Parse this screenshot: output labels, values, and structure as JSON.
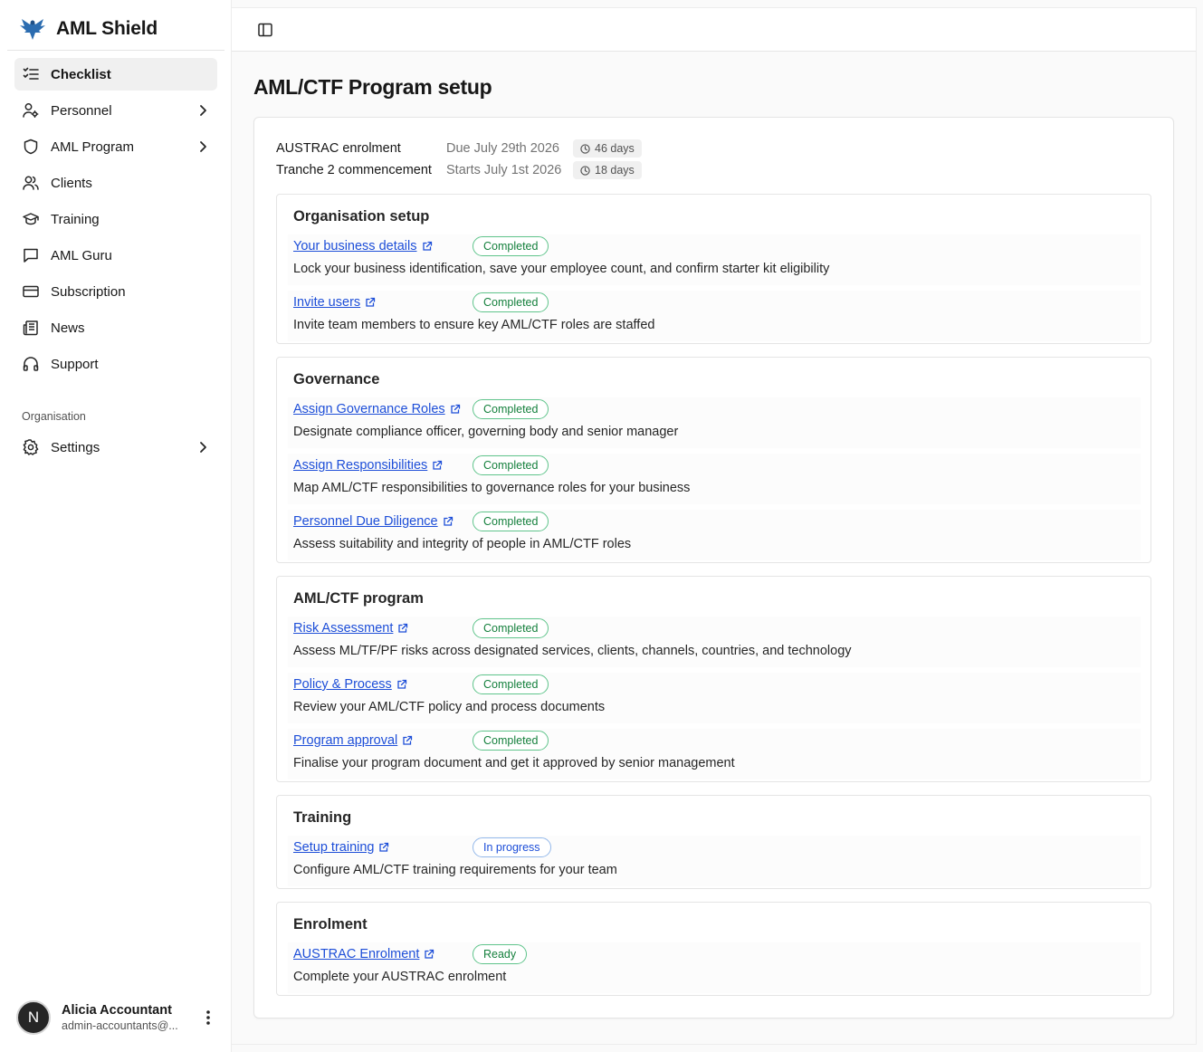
{
  "brand": {
    "name": "AML Shield",
    "logo_icon": "eagle-logo-icon",
    "accent": "#2b6cb0"
  },
  "sidebar": {
    "items": [
      {
        "label": "Checklist",
        "icon": "checklist-icon",
        "active": true,
        "has_chevron": false
      },
      {
        "label": "Personnel",
        "icon": "user-cog-icon",
        "active": false,
        "has_chevron": true
      },
      {
        "label": "AML Program",
        "icon": "shield-icon",
        "active": false,
        "has_chevron": true
      },
      {
        "label": "Clients",
        "icon": "users-icon",
        "active": false,
        "has_chevron": false
      },
      {
        "label": "Training",
        "icon": "graduation-cap-icon",
        "active": false,
        "has_chevron": false
      },
      {
        "label": "AML Guru",
        "icon": "message-square-icon",
        "active": false,
        "has_chevron": false
      },
      {
        "label": "Subscription",
        "icon": "credit-card-icon",
        "active": false,
        "has_chevron": false
      },
      {
        "label": "News",
        "icon": "newspaper-icon",
        "active": false,
        "has_chevron": false
      },
      {
        "label": "Support",
        "icon": "headphones-icon",
        "active": false,
        "has_chevron": false
      }
    ],
    "section_label": "Organisation",
    "settings": {
      "label": "Settings",
      "icon": "gear-icon"
    }
  },
  "user": {
    "initial": "N",
    "name": "Alicia Accountant",
    "email": "admin-accountants@..."
  },
  "page": {
    "title": "AML/CTF Program setup"
  },
  "deadlines": [
    {
      "label": "AUSTRAC enrolment",
      "date": "Due July 29th 2026",
      "badge": "46 days"
    },
    {
      "label": "Tranche 2 commencement",
      "date": "Starts July 1st 2026",
      "badge": "18 days"
    }
  ],
  "sections": [
    {
      "title": "Organisation setup",
      "tasks": [
        {
          "link": "Your business details",
          "status": "Completed",
          "desc": "Lock your business identification, save your employee count, and confirm starter kit eligibility"
        },
        {
          "link": "Invite users",
          "status": "Completed",
          "desc": "Invite team members to ensure key AML/CTF roles are staffed"
        }
      ]
    },
    {
      "title": "Governance",
      "tasks": [
        {
          "link": "Assign Governance Roles",
          "status": "Completed",
          "desc": "Designate compliance officer, governing body and senior manager"
        },
        {
          "link": "Assign Responsibilities",
          "status": "Completed",
          "desc": "Map AML/CTF responsibilities to governance roles for your business"
        },
        {
          "link": "Personnel Due Diligence",
          "status": "Completed",
          "desc": "Assess suitability and integrity of people in AML/CTF roles"
        }
      ]
    },
    {
      "title": "AML/CTF program",
      "tasks": [
        {
          "link": "Risk Assessment",
          "status": "Completed",
          "desc": "Assess ML/TF/PF risks across designated services, clients, channels, countries, and technology"
        },
        {
          "link": "Policy & Process",
          "status": "Completed",
          "desc": "Review your AML/CTF policy and process documents"
        },
        {
          "link": "Program approval",
          "status": "Completed",
          "desc": "Finalise your program document and get it approved by senior management"
        }
      ]
    },
    {
      "title": "Training",
      "tasks": [
        {
          "link": "Setup training",
          "status": "In progress",
          "desc": "Configure AML/CTF training requirements for your team"
        }
      ]
    },
    {
      "title": "Enrolment",
      "tasks": [
        {
          "link": "AUSTRAC Enrolment",
          "status": "Ready",
          "desc": "Complete your AUSTRAC enrolment"
        }
      ]
    }
  ],
  "colors": {
    "link": "#1d4ed8",
    "completed": "#15803d",
    "in_progress": "#1d4ed8"
  }
}
